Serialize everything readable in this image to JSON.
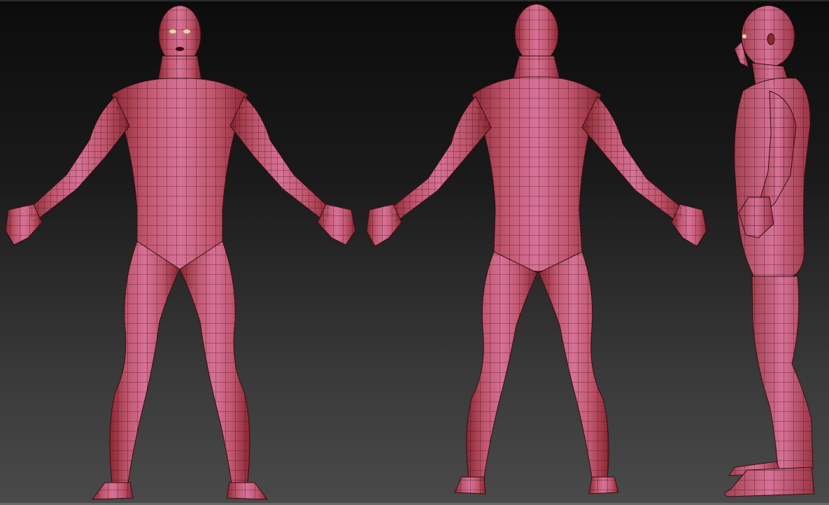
{
  "canvas": {
    "background_top": "#0c0c0c",
    "background_bottom": "#4a4a4a"
  },
  "material": {
    "light": "#d06a92",
    "mid": "#b04a60",
    "dark": "#7a1f24",
    "wire": "#3a0c12"
  },
  "views": [
    {
      "view": "front",
      "icon": "front-figure-icon"
    },
    {
      "view": "back",
      "icon": "back-figure-icon"
    },
    {
      "view": "side",
      "icon": "side-figure-icon"
    }
  ]
}
